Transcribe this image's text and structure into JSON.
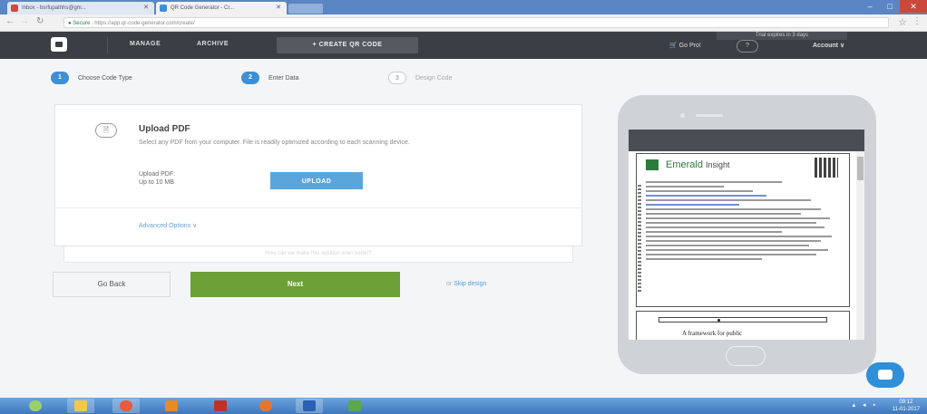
{
  "browser": {
    "tabs": [
      {
        "title": "Inbox - bsrfupathhs@gm...",
        "favicon_color": "#d44638"
      },
      {
        "title": "QR Code Generator - Cr...",
        "favicon_color": "#3d8fd6"
      }
    ],
    "window_controls": [
      "–",
      "□",
      "✕"
    ],
    "secure_label": "Secure",
    "url": "https://app.qr-code-generator.com/create/"
  },
  "header": {
    "nav": [
      "MANAGE",
      "ARCHIVE"
    ],
    "create_button": "+ CREATE QR CODE",
    "trial_notice": "Trial expires in 3 days",
    "go_pro": "Go Pro!",
    "help": "?",
    "account": "Account ∨"
  },
  "steps": [
    {
      "number": "1",
      "label": "Choose Code Type",
      "active": true
    },
    {
      "number": "2",
      "label": "Enter Data",
      "active": true
    },
    {
      "number": "3",
      "label": "Design Code",
      "active": false
    }
  ],
  "upload": {
    "title": "Upload PDF",
    "description": "Select any PDF from your computer. File is readily optimized according to each scanning device.",
    "label_line1": "Upload PDF:",
    "label_line2": "Up to 10 MB",
    "button": "UPLOAD",
    "advanced": "Advanced Options ∨",
    "feedback": "How can we make this solution even better?"
  },
  "actions": {
    "back": "Go Back",
    "next": "Next",
    "skip_prefix": "or",
    "skip_link": "Skip design"
  },
  "preview": {
    "brand": "Emerald",
    "brand_suffix": "Insight",
    "doc_title": "A framework for public"
  },
  "taskbar": {
    "clock_time": "09:12",
    "clock_date": "11-01-2017"
  },
  "colors": {
    "accent_blue": "#3d8fd6",
    "next_green": "#6aa035",
    "header_dark": "#3b3f45"
  }
}
